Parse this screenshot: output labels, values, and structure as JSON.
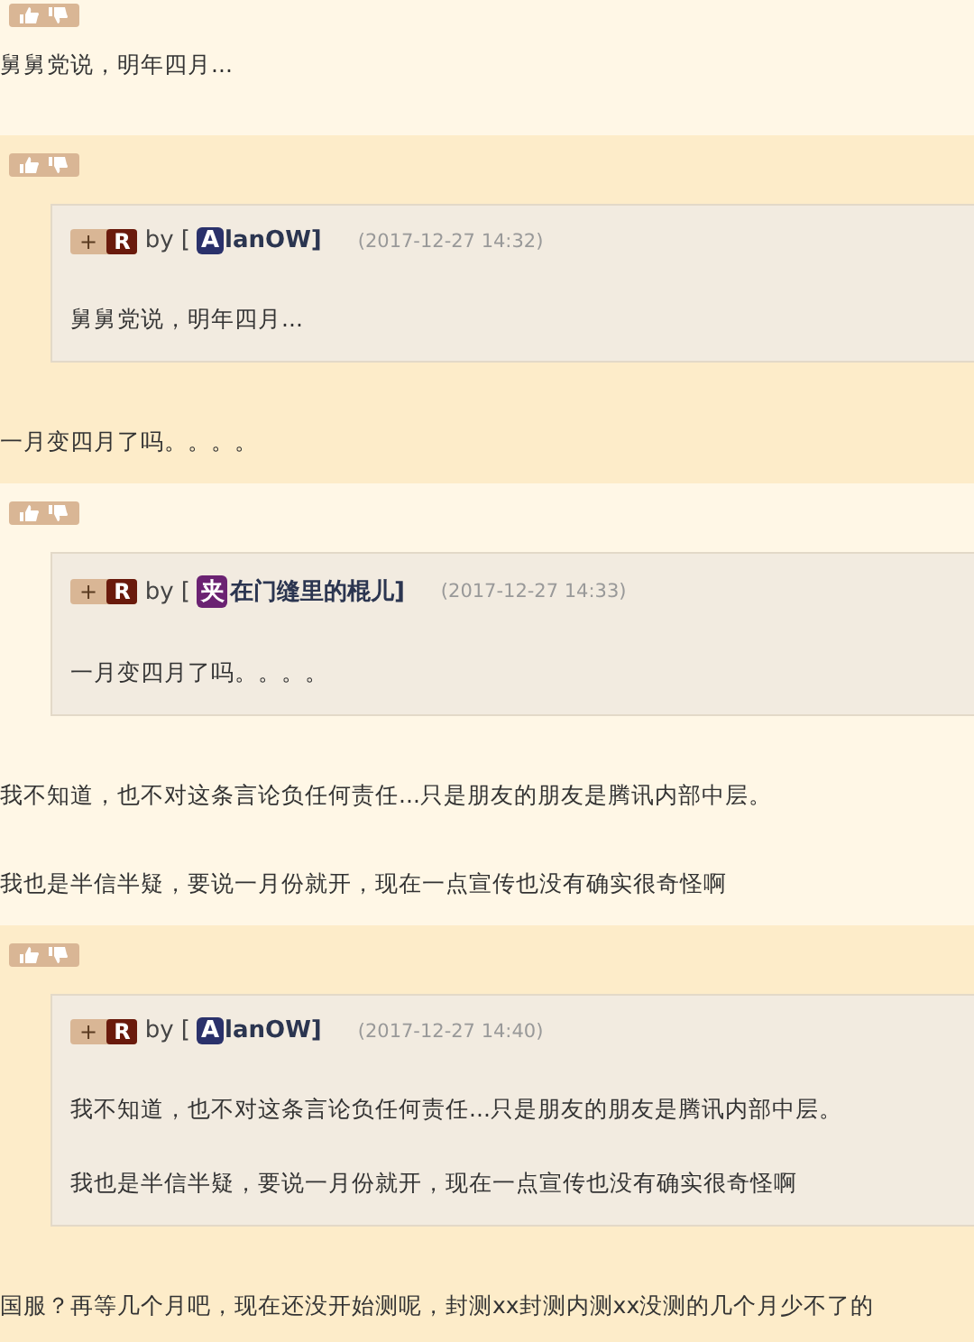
{
  "posts": [
    {
      "paragraphs": [
        "舅舅党说，明年四月..."
      ]
    },
    {
      "quote": {
        "plus": "+",
        "rank": "R",
        "by": "by [",
        "avatar": "A",
        "color": "#2a316b",
        "name": "lanOW]",
        "time": "(2017-12-27 14:32)",
        "paragraphs": [
          "舅舅党说，明年四月..."
        ]
      },
      "paragraphs": [
        "一月变四月了吗。。。。"
      ]
    },
    {
      "quote": {
        "plus": "+",
        "rank": "R",
        "by": "by [",
        "avatar": "夹",
        "color": "#6b2272",
        "name": "在门缝里的棍儿]",
        "time": "(2017-12-27 14:33)",
        "paragraphs": [
          "一月变四月了吗。。。。"
        ]
      },
      "paragraphs": [
        "我不知道，也不对这条言论负任何责任...只是朋友的朋友是腾讯内部中层。",
        "我也是半信半疑，要说一月份就开，现在一点宣传也没有确实很奇怪啊"
      ]
    },
    {
      "quote": {
        "plus": "+",
        "rank": "R",
        "by": "by [",
        "avatar": "A",
        "color": "#2a316b",
        "name": "lanOW]",
        "time": "(2017-12-27 14:40)",
        "paragraphs": [
          "我不知道，也不对这条言论负任何责任...只是朋友的朋友是腾讯内部中层。",
          "我也是半信半疑，要说一月份就开，现在一点宣传也没有确实很奇怪啊"
        ]
      },
      "paragraphs": [
        "国服？再等几个月吧，现在还没开始测呢，封测xx封测内测xx没测的几个月少不了的"
      ]
    }
  ]
}
